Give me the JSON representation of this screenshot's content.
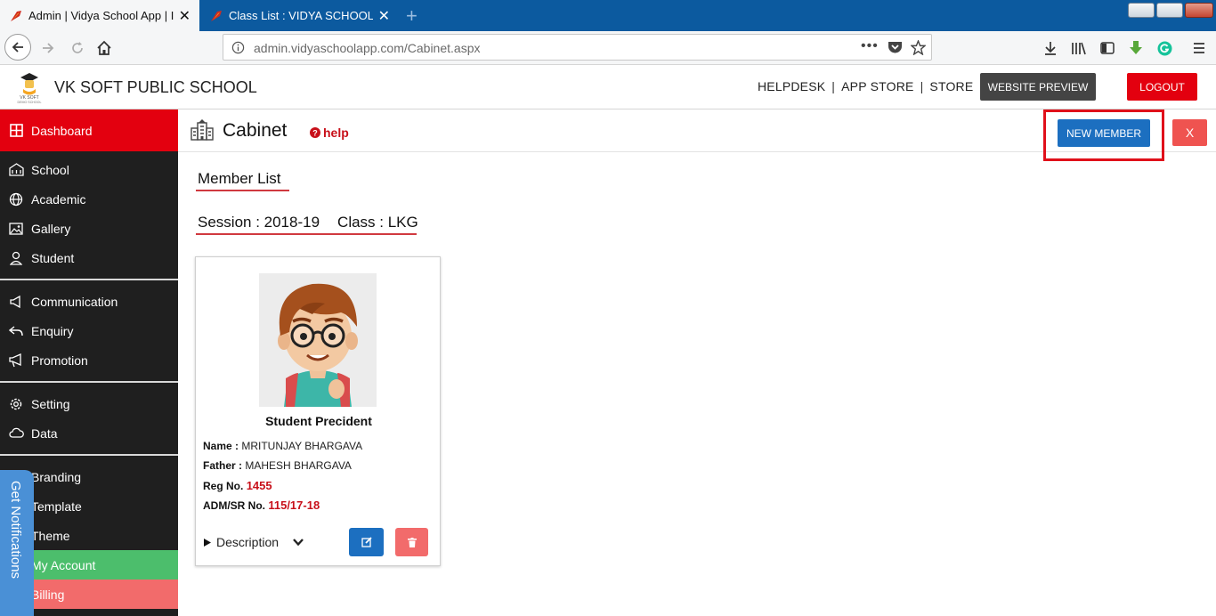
{
  "browser": {
    "tabs": [
      {
        "title": "Admin | Vidya School App | It's"
      },
      {
        "title": "Class List : VIDYA SCHOOL APP"
      }
    ],
    "url": "admin.vidyaschoolapp.com/Cabinet.aspx"
  },
  "header": {
    "school_name": "VK SOFT PUBLIC SCHOOL",
    "logo_caption": "VK SOFT DEMO SCHOOL",
    "links": [
      "HELPDESK",
      "APP STORE",
      "STORE"
    ],
    "link_separator": "|",
    "website_preview": "WEBSITE PREVIEW",
    "logout": "LOGOUT"
  },
  "sidebar": {
    "items": [
      {
        "label": "Dashboard",
        "icon": "dashboard-icon"
      },
      {
        "label": "School",
        "icon": "school-icon"
      },
      {
        "label": "Academic",
        "icon": "globe-icon"
      },
      {
        "label": "Gallery",
        "icon": "image-icon"
      },
      {
        "label": "Student",
        "icon": "student-icon"
      },
      {
        "label": "Communication",
        "icon": "megaphone-icon"
      },
      {
        "label": "Enquiry",
        "icon": "reply-icon"
      },
      {
        "label": "Promotion",
        "icon": "bullhorn-icon"
      },
      {
        "label": "Setting",
        "icon": "gear-icon"
      },
      {
        "label": "Data",
        "icon": "cloud-icon"
      },
      {
        "label": "Branding",
        "icon": "brush-icon"
      },
      {
        "label": "Template",
        "icon": "template-icon"
      },
      {
        "label": "Theme",
        "icon": "theme-icon"
      },
      {
        "label": "My Account",
        "icon": "account-icon"
      },
      {
        "label": "Billing",
        "icon": "billing-icon"
      }
    ],
    "notifications_tab": "Get Notifications"
  },
  "page": {
    "title": "Cabinet",
    "help": "help",
    "new_member": "NEW MEMBER",
    "close": "X",
    "section_title": "Member List",
    "session": "Session : 2018-19",
    "class": "Class : LKG"
  },
  "member": {
    "designation": "Student Precident",
    "name_label": "Name :",
    "name": "MRITUNJAY BHARGAVA",
    "father_label": "Father :",
    "father": "MAHESH BHARGAVA",
    "reg_label": "Reg No.",
    "reg": "1455",
    "adm_label": "ADM/SR No.",
    "adm": "115/17-18",
    "description": "Description"
  },
  "colors": {
    "accent_red": "#e3000f",
    "primary_blue": "#1c6fc0",
    "account_green": "#4cbe6c",
    "billing_salmon": "#f26b6b",
    "sidebar_bg": "#1f1f1f"
  }
}
